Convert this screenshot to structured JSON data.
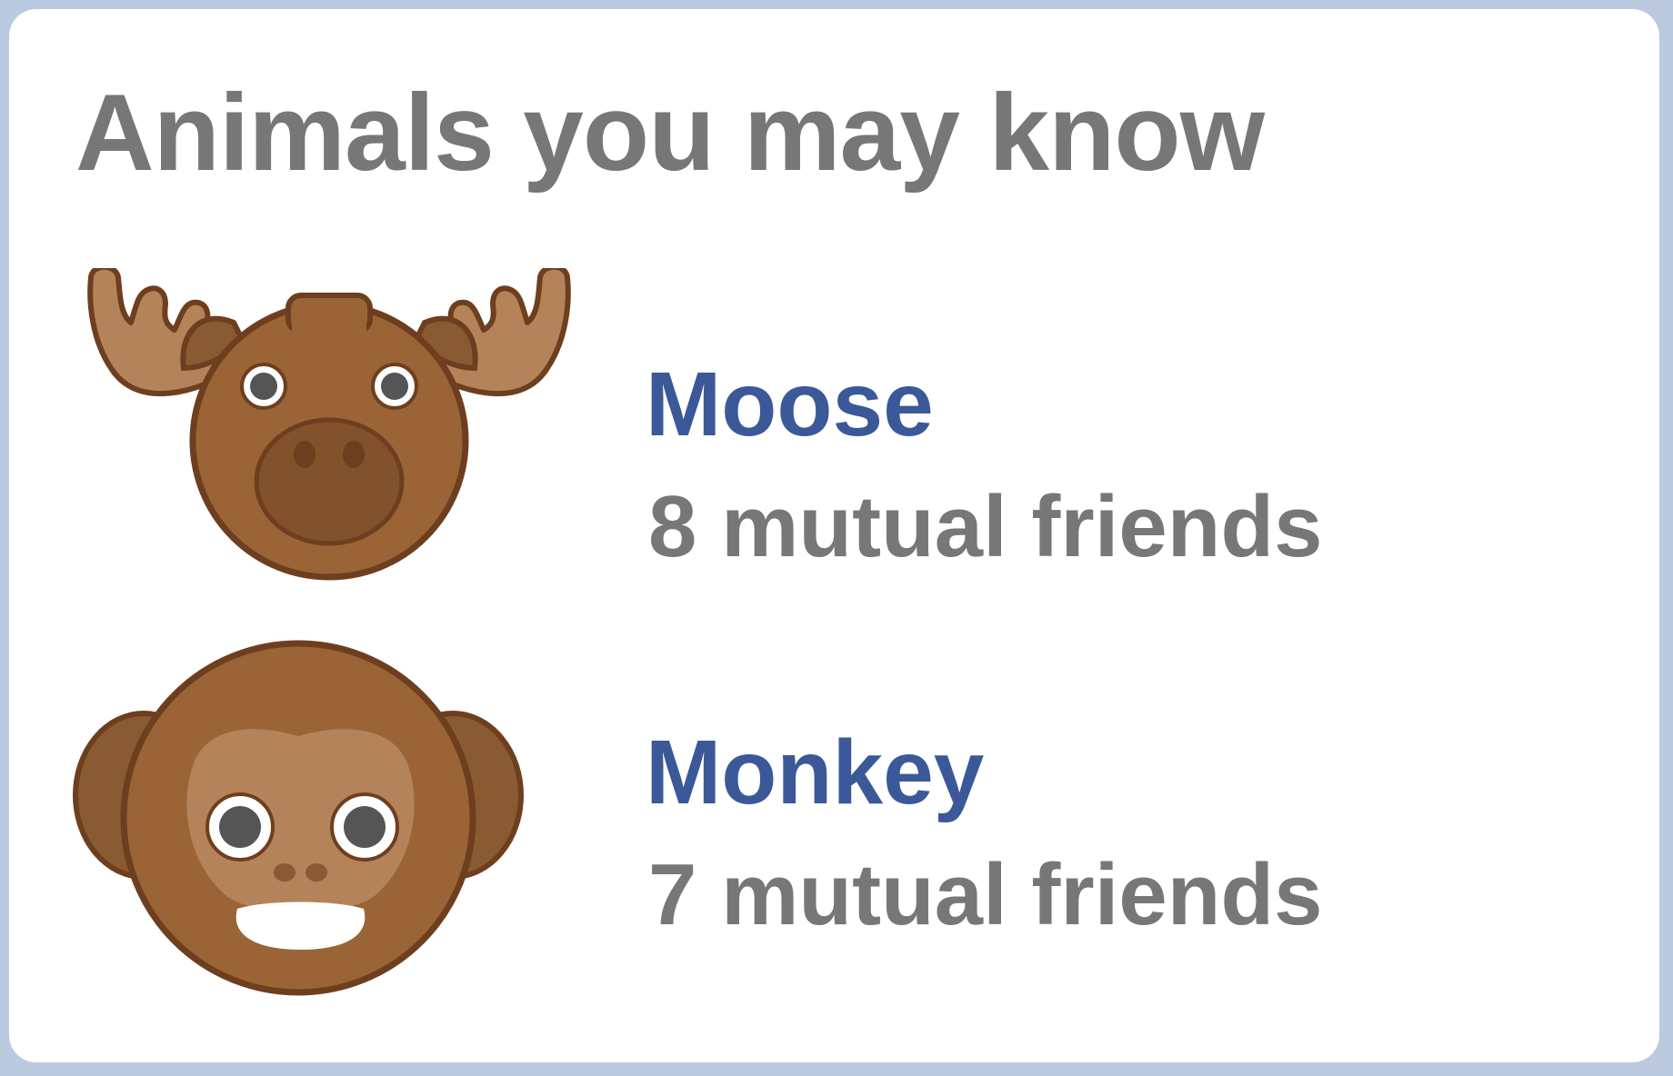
{
  "panel": {
    "title": "Animals you may know"
  },
  "suggestions": [
    {
      "name": "Moose",
      "mutual": "8 mutual friends",
      "icon": "moose-icon"
    },
    {
      "name": "Monkey",
      "mutual": "7 mutual friends",
      "icon": "monkey-icon"
    }
  ],
  "colors": {
    "background": "#bccae0",
    "card": "#ffffff",
    "name_link": "#3b5998",
    "secondary_text": "#777777",
    "animal_brown": "#9a6437",
    "animal_outline": "#6e3f1e"
  }
}
